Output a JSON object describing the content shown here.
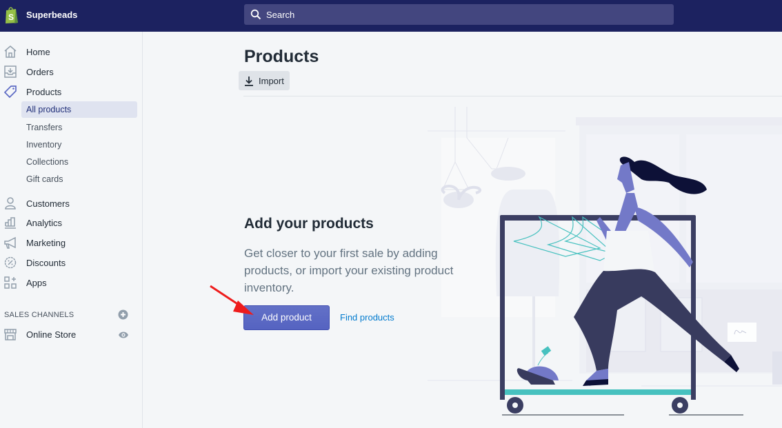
{
  "topbar": {
    "store_name": "Superbeads",
    "search_placeholder": "Search",
    "logo_icon": "shopify-bag-icon",
    "brand_color": "#1c2260"
  },
  "sidebar": {
    "items": [
      {
        "label": "Home",
        "icon": "home-icon"
      },
      {
        "label": "Orders",
        "icon": "orders-inbox-icon"
      },
      {
        "label": "Products",
        "icon": "tag-icon",
        "active": true
      },
      {
        "label": "Customers",
        "icon": "person-icon"
      },
      {
        "label": "Analytics",
        "icon": "bar-chart-icon"
      },
      {
        "label": "Marketing",
        "icon": "megaphone-icon"
      },
      {
        "label": "Discounts",
        "icon": "discount-badge-icon"
      },
      {
        "label": "Apps",
        "icon": "apps-grid-icon"
      }
    ],
    "product_subitems": [
      {
        "label": "All products",
        "active": true
      },
      {
        "label": "Transfers"
      },
      {
        "label": "Inventory"
      },
      {
        "label": "Collections"
      },
      {
        "label": "Gift cards"
      }
    ],
    "sales_channels": {
      "heading": "SALES CHANNELS",
      "items": [
        {
          "label": "Online Store",
          "icon": "store-icon",
          "action_icon": "eye-icon"
        }
      ]
    }
  },
  "main": {
    "title": "Products",
    "import_label": "Import",
    "empty_state": {
      "title": "Add your products",
      "description": "Get closer to your first sale by adding products, or import your existing product inventory.",
      "primary_action": "Add product",
      "secondary_action": "Find products"
    },
    "accent_color": "#5c6ac4",
    "annotation": "red-arrow-pointing-to-add-product"
  }
}
